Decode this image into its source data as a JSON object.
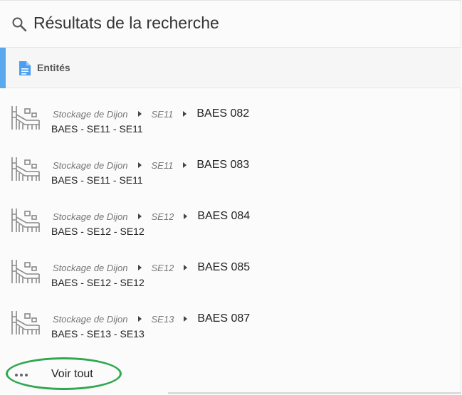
{
  "header": {
    "title": "Résultats de la recherche",
    "icon": "search-icon"
  },
  "section": {
    "label": "Entités",
    "icon": "document-icon",
    "accent_color": "#5aa9ef"
  },
  "results": [
    {
      "site": "Stockage de Dijon",
      "zone": "SE11",
      "name": "BAES 082",
      "subtitle": "BAES - SE11 - SE11",
      "icon": "facility-icon"
    },
    {
      "site": "Stockage de Dijon",
      "zone": "SE11",
      "name": "BAES 083",
      "subtitle": "BAES - SE11 - SE11",
      "icon": "facility-icon"
    },
    {
      "site": "Stockage de Dijon",
      "zone": "SE12",
      "name": "BAES 084",
      "subtitle": "BAES - SE12 - SE12",
      "icon": "facility-icon"
    },
    {
      "site": "Stockage de Dijon",
      "zone": "SE12",
      "name": "BAES 085",
      "subtitle": "BAES - SE12 - SE12",
      "icon": "facility-icon"
    },
    {
      "site": "Stockage de Dijon",
      "zone": "SE13",
      "name": "BAES 087",
      "subtitle": "BAES - SE13 - SE13",
      "icon": "facility-icon"
    }
  ],
  "footer": {
    "see_all_label": "Voir tout",
    "icon": "more-dots-icon",
    "highlight_color": "#2fa84f"
  }
}
